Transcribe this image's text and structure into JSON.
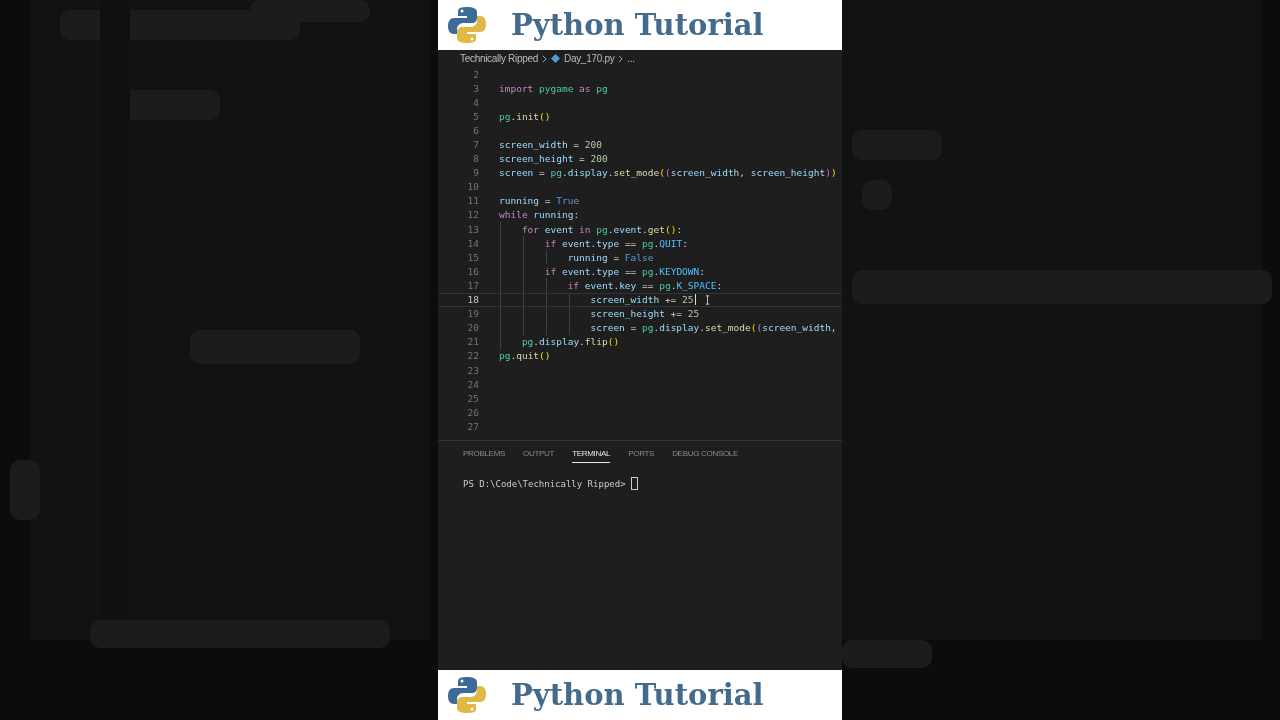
{
  "banners": [
    {
      "title": "Python Tutorial"
    },
    {
      "title": "Python Tutorial"
    }
  ],
  "breadcrumb": [
    {
      "label": "Technically Ripped",
      "kind": "folder"
    },
    {
      "label": "Day_170.py",
      "kind": "file"
    },
    {
      "label": "...",
      "kind": "more"
    }
  ],
  "editor": {
    "lines": [
      {
        "number": "2",
        "current": false
      },
      {
        "number": "3",
        "current": false,
        "tokens": [
          {
            "t": "import",
            "kind": "kw"
          },
          {
            "t": " pygame",
            "kind": "mod"
          },
          {
            "t": " as",
            "kind": "kw"
          },
          {
            "t": " pg",
            "kind": "mod"
          }
        ]
      },
      {
        "number": "4",
        "current": false
      },
      {
        "number": "5",
        "current": false,
        "tokens": [
          {
            "t": "pg",
            "kind": "mod"
          },
          {
            "t": ".",
            "kind": "punc"
          },
          {
            "t": "init",
            "kind": "fn"
          },
          {
            "t": "()",
            "kind": "br1"
          }
        ]
      },
      {
        "number": "6",
        "current": false
      },
      {
        "number": "7",
        "current": false,
        "tokens": [
          {
            "t": "screen_width",
            "kind": "var"
          },
          {
            "t": " = ",
            "kind": "punc"
          },
          {
            "t": "200",
            "kind": "num"
          }
        ]
      },
      {
        "number": "8",
        "current": false,
        "tokens": [
          {
            "t": "screen_height",
            "kind": "var"
          },
          {
            "t": " = ",
            "kind": "punc"
          },
          {
            "t": "200",
            "kind": "num"
          }
        ]
      },
      {
        "number": "9",
        "current": false,
        "tokens": [
          {
            "t": "screen",
            "kind": "var"
          },
          {
            "t": " = ",
            "kind": "punc"
          },
          {
            "t": "pg",
            "kind": "mod"
          },
          {
            "t": ".",
            "kind": "punc"
          },
          {
            "t": "display",
            "kind": "var"
          },
          {
            "t": ".",
            "kind": "punc"
          },
          {
            "t": "set_mode",
            "kind": "fn"
          },
          {
            "t": "(",
            "kind": "br1"
          },
          {
            "t": "(",
            "kind": "br2"
          },
          {
            "t": "screen_width",
            "kind": "var"
          },
          {
            "t": ", ",
            "kind": "punc"
          },
          {
            "t": "screen_height",
            "kind": "var"
          },
          {
            "t": ")",
            "kind": "br2"
          },
          {
            "t": ")",
            "kind": "br1"
          }
        ]
      },
      {
        "number": "10",
        "current": false
      },
      {
        "number": "11",
        "current": false,
        "tokens": [
          {
            "t": "running",
            "kind": "var"
          },
          {
            "t": " = ",
            "kind": "punc"
          },
          {
            "t": "True",
            "kind": "const"
          }
        ]
      },
      {
        "number": "12",
        "current": false,
        "tokens": [
          {
            "t": "while",
            "kind": "kw"
          },
          {
            "t": " running",
            "kind": "var"
          },
          {
            "t": ":",
            "kind": "punc"
          }
        ]
      },
      {
        "number": "13",
        "current": false,
        "tokens": [
          {
            "t": "    for",
            "kind": "kw"
          },
          {
            "t": " event",
            "kind": "var"
          },
          {
            "t": " in",
            "kind": "kw"
          },
          {
            "t": " pg",
            "kind": "mod"
          },
          {
            "t": ".",
            "kind": "punc"
          },
          {
            "t": "event",
            "kind": "var"
          },
          {
            "t": ".",
            "kind": "punc"
          },
          {
            "t": "get",
            "kind": "fn"
          },
          {
            "t": "()",
            "kind": "br1"
          },
          {
            "t": ":",
            "kind": "punc"
          }
        ]
      },
      {
        "number": "14",
        "current": false,
        "tokens": [
          {
            "t": "        if",
            "kind": "kw"
          },
          {
            "t": " event",
            "kind": "var"
          },
          {
            "t": ".",
            "kind": "punc"
          },
          {
            "t": "type",
            "kind": "var"
          },
          {
            "t": " == ",
            "kind": "punc"
          },
          {
            "t": "pg",
            "kind": "mod"
          },
          {
            "t": ".",
            "kind": "punc"
          },
          {
            "t": "QUIT",
            "kind": "cst"
          },
          {
            "t": ":",
            "kind": "punc"
          }
        ]
      },
      {
        "number": "15",
        "current": false,
        "tokens": [
          {
            "t": "            running",
            "kind": "var"
          },
          {
            "t": " = ",
            "kind": "punc"
          },
          {
            "t": "False",
            "kind": "const"
          }
        ]
      },
      {
        "number": "16",
        "current": false,
        "tokens": [
          {
            "t": "        if",
            "kind": "kw"
          },
          {
            "t": " event",
            "kind": "var"
          },
          {
            "t": ".",
            "kind": "punc"
          },
          {
            "t": "type",
            "kind": "var"
          },
          {
            "t": " == ",
            "kind": "punc"
          },
          {
            "t": "pg",
            "kind": "mod"
          },
          {
            "t": ".",
            "kind": "punc"
          },
          {
            "t": "KEYDOWN",
            "kind": "cst"
          },
          {
            "t": ":",
            "kind": "punc"
          }
        ]
      },
      {
        "number": "17",
        "current": false,
        "tokens": [
          {
            "t": "            if",
            "kind": "kw"
          },
          {
            "t": " event",
            "kind": "var"
          },
          {
            "t": ".",
            "kind": "punc"
          },
          {
            "t": "key",
            "kind": "var"
          },
          {
            "t": " == ",
            "kind": "punc"
          },
          {
            "t": "pg",
            "kind": "mod"
          },
          {
            "t": ".",
            "kind": "punc"
          },
          {
            "t": "K_SPACE",
            "kind": "cst"
          },
          {
            "t": ":",
            "kind": "punc"
          }
        ]
      },
      {
        "number": "18",
        "current": true,
        "tokens": [
          {
            "t": "                screen_width",
            "kind": "var"
          },
          {
            "t": " += ",
            "kind": "punc"
          },
          {
            "t": "25",
            "kind": "num"
          }
        ]
      },
      {
        "number": "19",
        "current": false,
        "tokens": [
          {
            "t": "                screen_height",
            "kind": "var"
          },
          {
            "t": " += ",
            "kind": "punc"
          },
          {
            "t": "25",
            "kind": "num"
          }
        ]
      },
      {
        "number": "20",
        "current": false,
        "tokens": [
          {
            "t": "                screen",
            "kind": "var"
          },
          {
            "t": " = ",
            "kind": "punc"
          },
          {
            "t": "pg",
            "kind": "mod"
          },
          {
            "t": ".",
            "kind": "punc"
          },
          {
            "t": "display",
            "kind": "var"
          },
          {
            "t": ".",
            "kind": "punc"
          },
          {
            "t": "set_mode",
            "kind": "fn"
          },
          {
            "t": "(",
            "kind": "br1"
          },
          {
            "t": "(",
            "kind": "br2"
          },
          {
            "t": "screen_width",
            "kind": "var"
          },
          {
            "t": ",",
            "kind": "punc"
          }
        ]
      },
      {
        "number": "21",
        "current": false,
        "tokens": [
          {
            "t": "    pg",
            "kind": "mod"
          },
          {
            "t": ".",
            "kind": "punc"
          },
          {
            "t": "display",
            "kind": "var"
          },
          {
            "t": ".",
            "kind": "punc"
          },
          {
            "t": "flip",
            "kind": "fn"
          },
          {
            "t": "()",
            "kind": "br1"
          }
        ]
      },
      {
        "number": "22",
        "current": false,
        "tokens": [
          {
            "t": "pg",
            "kind": "mod"
          },
          {
            "t": ".",
            "kind": "punc"
          },
          {
            "t": "quit",
            "kind": "fn"
          },
          {
            "t": "()",
            "kind": "br1"
          }
        ]
      },
      {
        "number": "23",
        "current": false
      },
      {
        "number": "24",
        "current": false
      },
      {
        "number": "25",
        "current": false
      },
      {
        "number": "26",
        "current": false
      },
      {
        "number": "27",
        "current": false
      }
    ]
  },
  "panel": {
    "tabs": [
      {
        "label": "PROBLEMS",
        "selected": false
      },
      {
        "label": "OUTPUT",
        "selected": false
      },
      {
        "label": "TERMINAL",
        "selected": true
      },
      {
        "label": "PORTS",
        "selected": false
      },
      {
        "label": "DEBUG CONSOLE",
        "selected": false
      }
    ],
    "terminal": {
      "prompt": "PS D:\\Code\\Technically Ripped>"
    }
  }
}
